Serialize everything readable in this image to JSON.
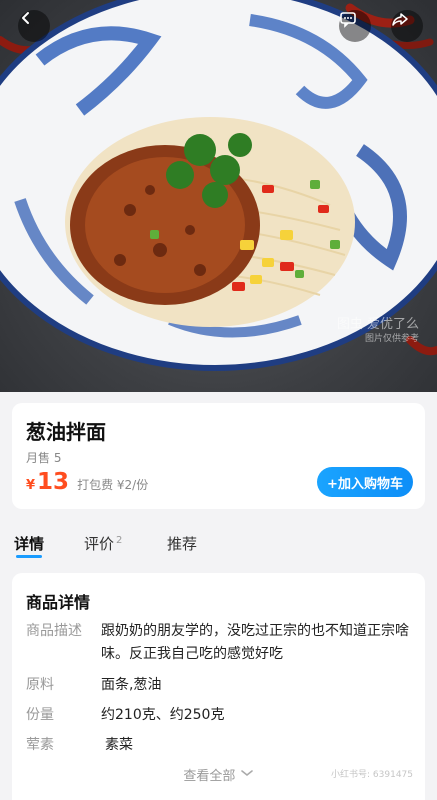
{
  "product": {
    "name": "葱油拌面",
    "monthly_sales": "月售 5",
    "currency": "¥",
    "price": "13",
    "packing_fee": "打包费 ¥2/份",
    "add_to_cart": "+加入购物车"
  },
  "watermark": {
    "main": "图虫  爱优了么",
    "sub": "图片仅供参考"
  },
  "tabs": {
    "detail": "详情",
    "review": "评价",
    "review_count": "2",
    "recommend": "推荐"
  },
  "details": {
    "title": "商品详情",
    "rows": [
      {
        "label": "商品描述",
        "value": "跟奶奶的朋友学的，没吃过正宗的也不知道正宗啥味。反正我自己吃的感觉好吃"
      },
      {
        "label": "原料",
        "value": "面条,葱油"
      },
      {
        "label": "份量",
        "value": "约210克、约250克"
      },
      {
        "label": "荤素",
        "value": "素菜"
      }
    ],
    "view_all": "查看全部",
    "watermark": "小红书号: 6391475"
  },
  "colors": {
    "accent_blue": "#1a9cff",
    "price_red": "#ff4d1f"
  },
  "icons": [
    "back-arrow-icon",
    "message-icon",
    "share-icon",
    "chevron-down-icon"
  ]
}
